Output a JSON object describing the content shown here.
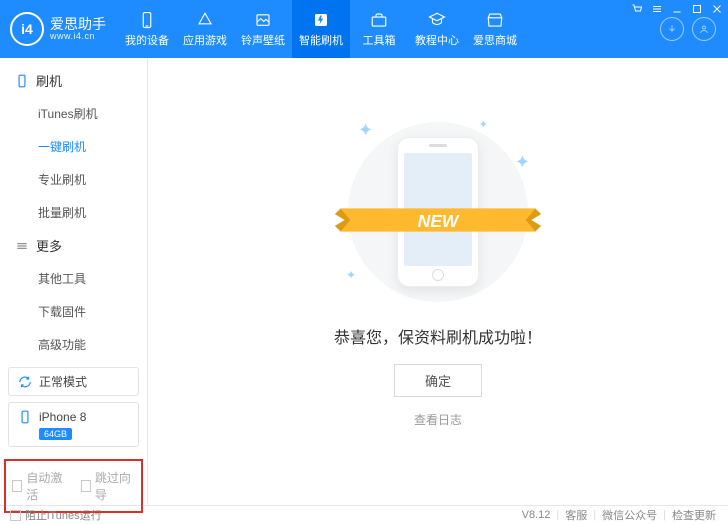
{
  "app": {
    "name": "爱思助手",
    "url": "www.i4.cn",
    "logo_text": "i4",
    "version": "V8.12"
  },
  "nav": {
    "items": [
      {
        "label": "我的设备",
        "icon": "device"
      },
      {
        "label": "应用游戏",
        "icon": "apps"
      },
      {
        "label": "铃声壁纸",
        "icon": "wallpaper"
      },
      {
        "label": "智能刷机",
        "icon": "flash",
        "active": true
      },
      {
        "label": "工具箱",
        "icon": "toolbox"
      },
      {
        "label": "教程中心",
        "icon": "tutorial"
      },
      {
        "label": "爱思商城",
        "icon": "store"
      }
    ]
  },
  "sidebar": {
    "groups": [
      {
        "title": "刷机",
        "items": [
          "iTunes刷机",
          "一键刷机",
          "专业刷机",
          "批量刷机"
        ],
        "active_index": 1
      },
      {
        "title": "更多",
        "items": [
          "其他工具",
          "下载固件",
          "高级功能"
        ]
      }
    ],
    "mode": "正常模式",
    "device": {
      "name": "iPhone 8",
      "storage": "64GB"
    },
    "options": {
      "auto_activate": "自动激活",
      "skip_wizard": "跳过向导"
    }
  },
  "main": {
    "ribbon": "NEW",
    "message": "恭喜您，保资料刷机成功啦！",
    "ok": "确定",
    "view_log": "查看日志"
  },
  "footer": {
    "block_itunes": "阻止iTunes运行",
    "items": [
      "客服",
      "微信公众号",
      "检查更新"
    ]
  }
}
